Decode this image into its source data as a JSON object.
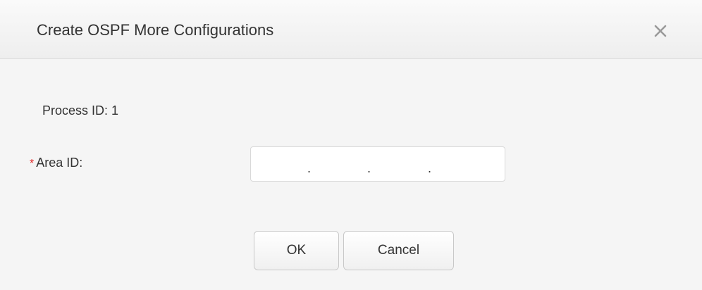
{
  "dialog": {
    "title": "Create OSPF More Configurations",
    "close_icon": "close-icon"
  },
  "form": {
    "process_id_text": "Process ID: 1",
    "area_id": {
      "required_mark": "*",
      "label": "Area ID:",
      "ip_separators": [
        ".",
        ".",
        "."
      ]
    }
  },
  "buttons": {
    "ok_label": "OK",
    "cancel_label": "Cancel"
  },
  "colors": {
    "required": "#e02020",
    "text": "#333333",
    "background": "#f5f5f5"
  }
}
